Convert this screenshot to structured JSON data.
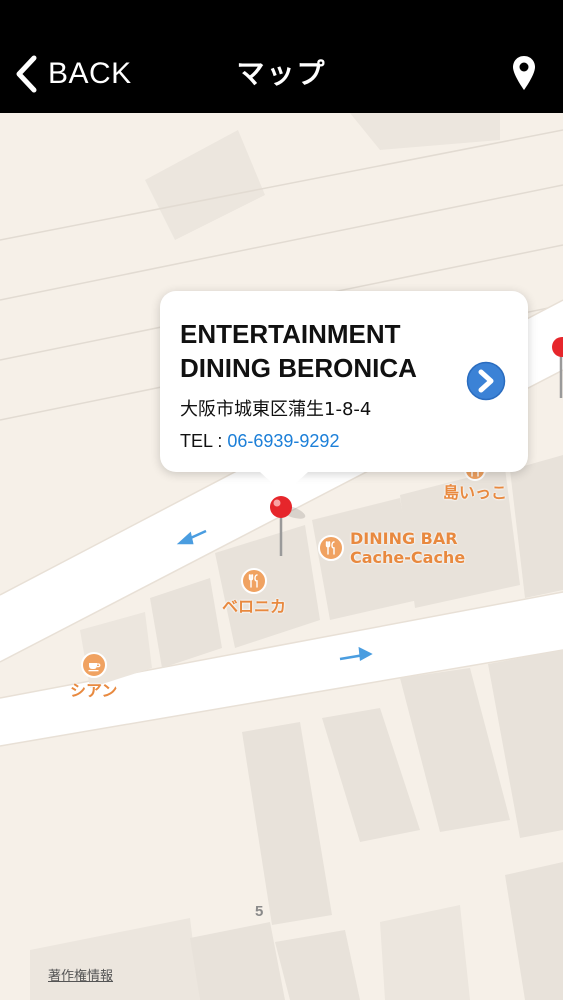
{
  "header": {
    "back_label": "BACK",
    "title": "マップ",
    "back_icon": "chevron-left-icon",
    "pin_icon": "location-pin-icon"
  },
  "callout": {
    "name": "ENTERTAINMENT DINING BERONICA",
    "address": "大阪市城東区蒲生1-8-4",
    "tel_prefix": "TEL : ",
    "tel_number": "06-6939-9292",
    "detail_icon": "chevron-right-circle-icon"
  },
  "pois": [
    {
      "label": "島いっこ",
      "icon": "restaurant-icon"
    },
    {
      "label": "DINING BAR",
      "label2": "Cache-Cache",
      "icon": "restaurant-icon"
    },
    {
      "label": "ベロニカ",
      "icon": "restaurant-icon"
    },
    {
      "label": "シアン",
      "icon": "cafe-icon"
    }
  ],
  "map": {
    "block_number": "5",
    "legal_label": "著作権情報"
  },
  "colors": {
    "header_bg": "#000000",
    "map_bg": "#f6f0e8",
    "road": "#ffffff",
    "building": "#e8e2da",
    "poi": "#e8893f",
    "tel_link": "#1c7fd8",
    "pin": "#e6262b",
    "detail_button": "#3b82d6"
  }
}
